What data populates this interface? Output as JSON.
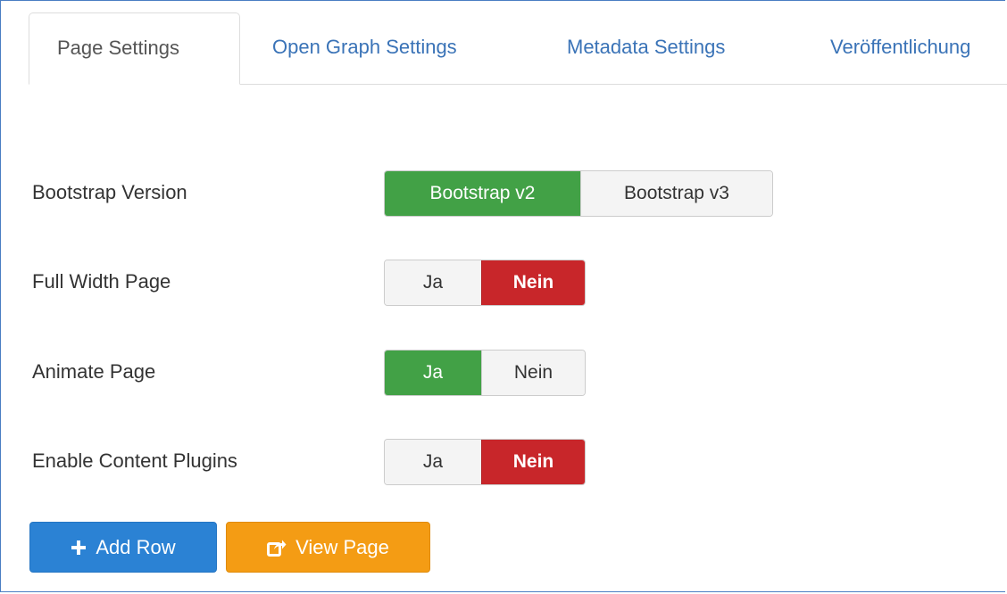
{
  "tabs": [
    {
      "label": "Page Settings",
      "active": true
    },
    {
      "label": "Open Graph Settings",
      "active": false
    },
    {
      "label": "Metadata Settings",
      "active": false
    },
    {
      "label": "Veröffentlichung",
      "active": false
    }
  ],
  "settings": {
    "bootstrap_version": {
      "label": "Bootstrap Version",
      "options": [
        "Bootstrap v2",
        "Bootstrap v3"
      ],
      "selected": "Bootstrap v2"
    },
    "full_width_page": {
      "label": "Full Width Page",
      "options": [
        "Ja",
        "Nein"
      ],
      "selected": "Nein"
    },
    "animate_page": {
      "label": "Animate Page",
      "options": [
        "Ja",
        "Nein"
      ],
      "selected": "Ja"
    },
    "enable_content_plugins": {
      "label": "Enable Content Plugins",
      "options": [
        "Ja",
        "Nein"
      ],
      "selected": "Nein"
    }
  },
  "actions": {
    "add_row": {
      "label": "Add Row",
      "icon": "plus-icon"
    },
    "view_page": {
      "label": "View Page",
      "icon": "external-link-icon"
    }
  },
  "colors": {
    "tab_link": "#3a73b7",
    "selected_green": "#42a146",
    "selected_red": "#c8262a",
    "add_row_blue": "#2b82d4",
    "view_page_orange": "#f49c14",
    "frame_border": "#4a7ec3"
  }
}
